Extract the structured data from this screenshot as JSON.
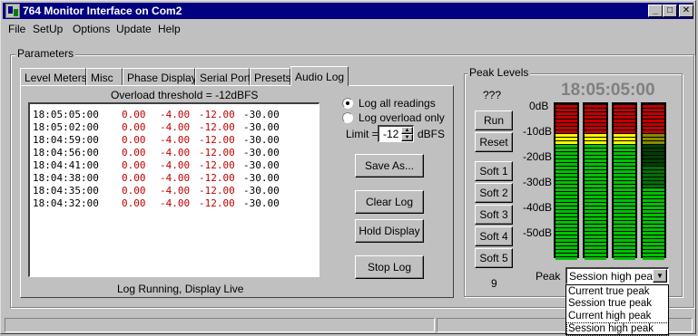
{
  "window": {
    "title": "764 Monitor Interface on Com2"
  },
  "menu": [
    "File",
    "SetUp",
    "Options",
    "Update",
    "Help"
  ],
  "parameters": {
    "group_label": "Parameters",
    "tabs": [
      "Level Meters",
      "Misc",
      "Phase Display",
      "Serial Port",
      "Presets",
      "Audio Log"
    ],
    "active_tab": "Audio Log",
    "threshold_label": "Overload threshold = -12dBFS",
    "log_rows": [
      [
        "18:05:05:00",
        "0.00",
        "-4.00",
        "-12.00",
        "-30.00"
      ],
      [
        "18:05:02:00",
        "0.00",
        "-4.00",
        "-12.00",
        "-30.00"
      ],
      [
        "18:04:59:00",
        "0.00",
        "-4.00",
        "-12.00",
        "-30.00"
      ],
      [
        "18:04:56:00",
        "0.00",
        "-4.00",
        "-12.00",
        "-30.00"
      ],
      [
        "18:04:41:00",
        "0.00",
        "-4.00",
        "-12.00",
        "-30.00"
      ],
      [
        "18:04:38:00",
        "0.00",
        "-4.00",
        "-12.00",
        "-30.00"
      ],
      [
        "18:04:35:00",
        "0.00",
        "-4.00",
        "-12.00",
        "-30.00"
      ],
      [
        "18:04:32:00",
        "0.00",
        "-4.00",
        "-12.00",
        "-30.00"
      ]
    ],
    "radio_all": "Log all readings",
    "radio_overload": "Log overload only",
    "radio_selected": "all",
    "limit_label": "Limit =",
    "limit_value": "-12",
    "limit_unit": "dBFS",
    "buttons": {
      "save_as": "Save As...",
      "clear_log": "Clear Log",
      "hold_display": "Hold Display",
      "stop_log": "Stop Log"
    },
    "status": "Log Running, Display Live"
  },
  "peak": {
    "group_label": "Peak Levels",
    "unknown": "???",
    "timecode": "18:05:05:00",
    "buttons": {
      "run": "Run",
      "reset": "Reset",
      "soft1": "Soft 1",
      "soft2": "Soft 2",
      "soft3": "Soft 3",
      "soft4": "Soft 4",
      "soft5": "Soft 5"
    },
    "count": "9",
    "scale": [
      "0dB",
      "-10dB",
      "-20dB",
      "-30dB",
      "-40dB",
      "-50dB"
    ],
    "peak_label": "Peak",
    "peak_selected": "Session high peak",
    "peak_options": [
      "Current true peak",
      "Session true peak",
      "Current high peak",
      "Session high peak"
    ],
    "colors": {
      "red": "#c00000",
      "yellow": "#ffff00",
      "green": "#00c000",
      "timecode": "#808080"
    }
  }
}
